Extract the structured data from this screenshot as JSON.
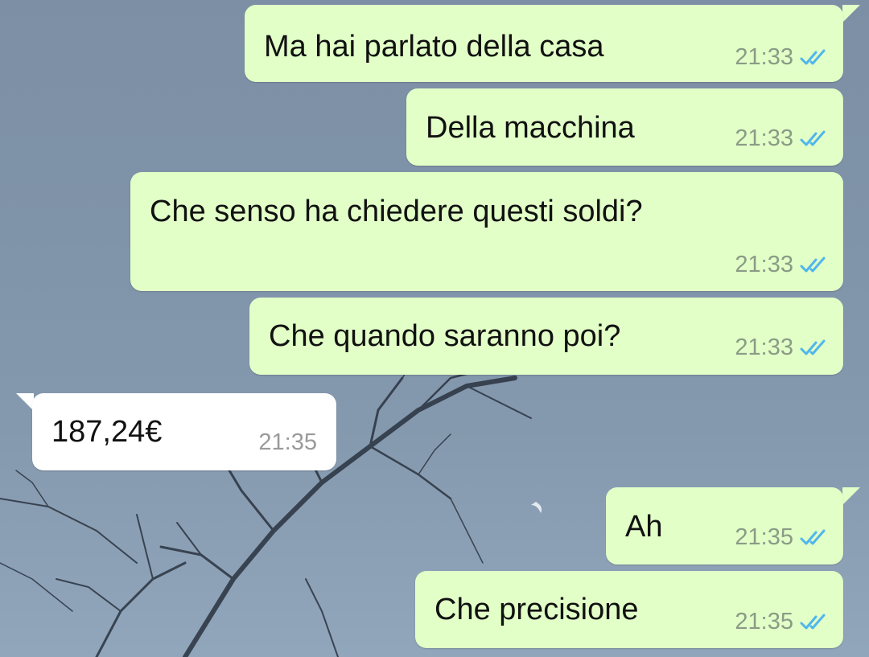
{
  "messages": [
    {
      "text": "Ma hai parlato della casa",
      "time": "21:33",
      "direction": "outgoing",
      "status": "read"
    },
    {
      "text": "Della macchina",
      "time": "21:33",
      "direction": "outgoing",
      "status": "read"
    },
    {
      "text": "Che senso ha chiedere questi soldi?",
      "time": "21:33",
      "direction": "outgoing",
      "status": "read"
    },
    {
      "text": "Che quando saranno poi?",
      "time": "21:33",
      "direction": "outgoing",
      "status": "read"
    },
    {
      "text": "187,24€",
      "time": "21:35",
      "direction": "incoming"
    },
    {
      "text": "Ah",
      "time": "21:35",
      "direction": "outgoing",
      "status": "read"
    },
    {
      "text": "Che precisione",
      "time": "21:35",
      "direction": "outgoing",
      "status": "read"
    }
  ],
  "colors": {
    "outgoing_bubble": "#e2ffc7",
    "incoming_bubble": "#ffffff",
    "read_ticks": "#4fb6ec",
    "time_text": "#8a9b86"
  },
  "icons": {
    "read_status": "double-check-icon"
  }
}
